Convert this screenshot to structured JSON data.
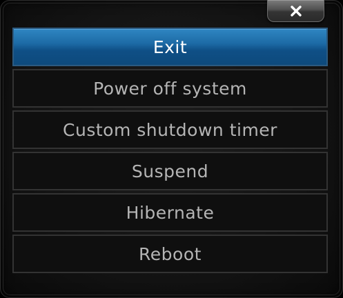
{
  "dialog": {
    "close_icon": "close-icon",
    "menu": [
      {
        "id": "exit",
        "label": "Exit",
        "selected": true
      },
      {
        "id": "power-off-system",
        "label": "Power off system",
        "selected": false
      },
      {
        "id": "custom-shutdown-timer",
        "label": "Custom shutdown timer",
        "selected": false
      },
      {
        "id": "suspend",
        "label": "Suspend",
        "selected": false
      },
      {
        "id": "hibernate",
        "label": "Hibernate",
        "selected": false
      },
      {
        "id": "reboot",
        "label": "Reboot",
        "selected": false
      }
    ]
  },
  "colors": {
    "selected_highlight": "#1d6ba6",
    "item_border": "#333333",
    "item_text": "#b5b5b5",
    "selected_text": "#ffffff"
  }
}
